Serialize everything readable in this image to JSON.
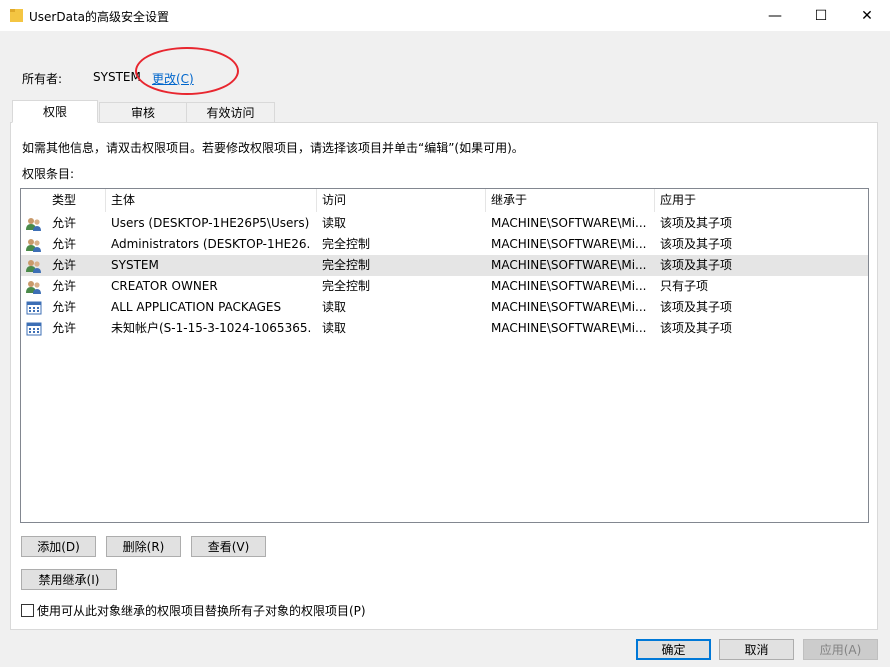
{
  "window": {
    "title": "UserData的高级安全设置",
    "minimize": "—",
    "maximize": "☐",
    "close": "✕"
  },
  "owner": {
    "label": "所有者:",
    "value": "SYSTEM",
    "change_link": "更改(C)"
  },
  "tabs": [
    {
      "label": "权限",
      "active": true
    },
    {
      "label": "审核",
      "active": false
    },
    {
      "label": "有效访问",
      "active": false
    }
  ],
  "info_text": "如需其他信息，请双击权限项目。若要修改权限项目，请选择该项目并单击“编辑”(如果可用)。",
  "permissions_label": "权限条目:",
  "columns": [
    "类型",
    "主体",
    "访问",
    "继承于",
    "应用于"
  ],
  "entries": [
    {
      "icon": "users-group-icon",
      "type": "允许",
      "principal": "Users (DESKTOP-1HE26P5\\Users)",
      "access": "读取",
      "inherited": "MACHINE\\SOFTWARE\\Mi...",
      "applies": "该项及其子项",
      "selected": false
    },
    {
      "icon": "users-group-icon",
      "type": "允许",
      "principal": "Administrators (DESKTOP-1HE26...",
      "access": "完全控制",
      "inherited": "MACHINE\\SOFTWARE\\Mi...",
      "applies": "该项及其子项",
      "selected": false
    },
    {
      "icon": "users-group-icon",
      "type": "允许",
      "principal": "SYSTEM",
      "access": "完全控制",
      "inherited": "MACHINE\\SOFTWARE\\Mi...",
      "applies": "该项及其子项",
      "selected": true
    },
    {
      "icon": "users-group-icon",
      "type": "允许",
      "principal": "CREATOR OWNER",
      "access": "完全控制",
      "inherited": "MACHINE\\SOFTWARE\\Mi...",
      "applies": "只有子项",
      "selected": false
    },
    {
      "icon": "app-package-icon",
      "type": "允许",
      "principal": "ALL APPLICATION PACKAGES",
      "access": "读取",
      "inherited": "MACHINE\\SOFTWARE\\Mi...",
      "applies": "该项及其子项",
      "selected": false
    },
    {
      "icon": "app-package-icon",
      "type": "允许",
      "principal": "未知帐户(S-1-15-3-1024-1065365...",
      "access": "读取",
      "inherited": "MACHINE\\SOFTWARE\\Mi...",
      "applies": "该项及其子项",
      "selected": false
    }
  ],
  "buttons": {
    "add": "添加(D)",
    "remove": "删除(R)",
    "view": "查看(V)",
    "disable_inheritance": "禁用继承(I)",
    "ok": "确定",
    "cancel": "取消",
    "apply": "应用(A)"
  },
  "replace_checkbox": {
    "label": "使用可从此对象继承的权限项目替换所有子对象的权限项目(P)",
    "checked": false
  },
  "colors": {
    "link": "#0066cc",
    "highlight_ellipse": "#e8262f",
    "selected_row": "#e5e5e5",
    "primary_border": "#0078d7"
  }
}
